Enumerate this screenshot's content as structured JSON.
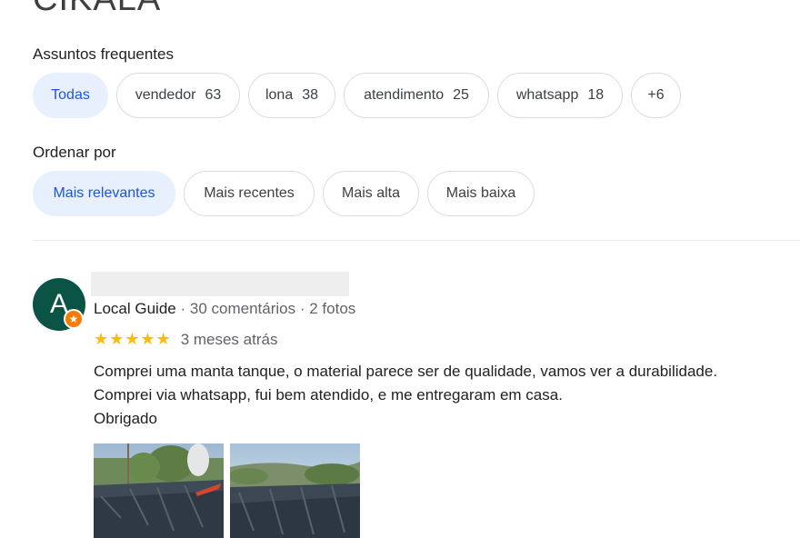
{
  "business": {
    "title": "CIKALA"
  },
  "topics": {
    "label": "Assuntos frequentes",
    "chips": [
      {
        "label": "Todas",
        "count": ""
      },
      {
        "label": "vendedor",
        "count": "63"
      },
      {
        "label": "lona",
        "count": "38"
      },
      {
        "label": "atendimento",
        "count": "25"
      },
      {
        "label": "whatsapp",
        "count": "18"
      },
      {
        "label": "+6",
        "count": ""
      }
    ]
  },
  "sort": {
    "label": "Ordenar por",
    "options": [
      "Mais relevantes",
      "Mais recentes",
      "Mais alta",
      "Mais baixa"
    ]
  },
  "review": {
    "avatar_letter": "A",
    "reviewer_type": "Local Guide",
    "comments": "30 comentários",
    "photos": "2 fotos",
    "separator": "·",
    "stars": "★★★★★",
    "rating": 5,
    "date": "3 meses atrás",
    "lines": [
      "Comprei uma manta tanque, o material parece ser de qualidade, vamos ver a durabilidade.",
      "Comprei via whatsapp, fui bem atendido, e me entregaram em casa.",
      "Obrigado"
    ]
  },
  "colors": {
    "selected_chip_bg": "#e8f0fe",
    "selected_chip_text": "#1a57d6",
    "star": "#fbbc04",
    "avatar": "#0b5345",
    "local_guide_badge": "#f57c00"
  }
}
